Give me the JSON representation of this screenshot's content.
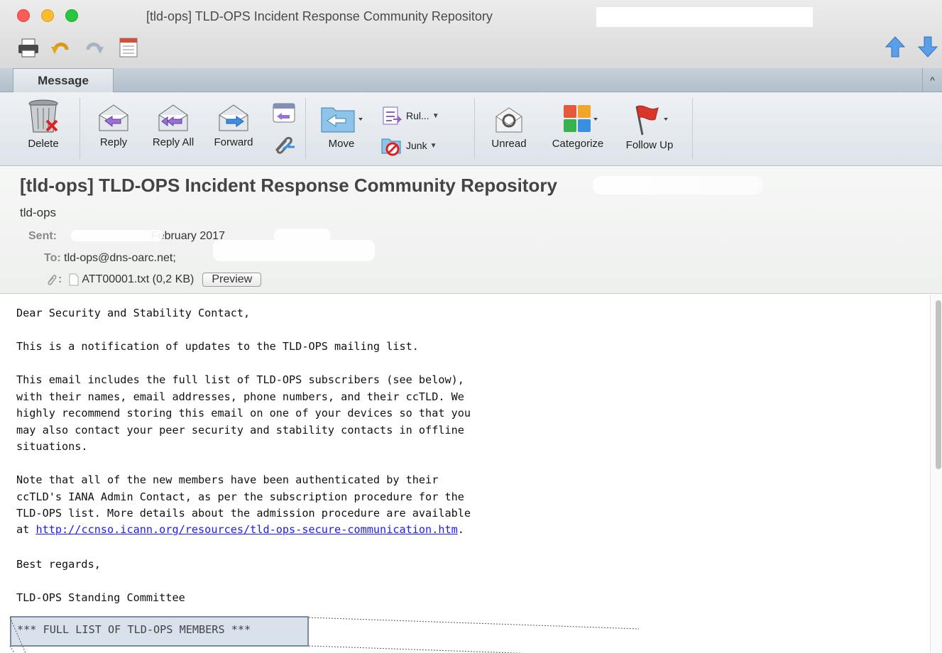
{
  "window": {
    "title": "[tld-ops] TLD-OPS Incident Response Community Repository"
  },
  "quick_toolbar": {
    "icons": [
      "print-icon",
      "undo-icon",
      "redo-icon",
      "calendar-view-icon"
    ],
    "nav_icons": [
      "previous-message-icon",
      "next-message-icon"
    ]
  },
  "tabs": {
    "message": "Message",
    "collapse": "^"
  },
  "ribbon": {
    "delete": "Delete",
    "reply": "Reply",
    "reply_all": "Reply All",
    "forward": "Forward",
    "move": "Move",
    "rules": "Rul...",
    "junk": "Junk",
    "unread": "Unread",
    "categorize": "Categorize",
    "follow_up": "Follow Up"
  },
  "header": {
    "subject": "[tld-ops] TLD-OPS Incident Response Community Repository",
    "sender": "tld-ops",
    "sent_label": "Sent:",
    "sent_value": "February 2017",
    "to_label": "To:",
    "to_value": "tld-ops@dns-oarc.net;",
    "attachment_label": ":",
    "attachment": "ATT00001.txt (0,2 KB)",
    "preview": "Preview"
  },
  "body": {
    "greeting": "Dear Security and Stability Contact,",
    "p1": "This is a notification of updates to the TLD-OPS mailing list.",
    "p2": "This email includes the full list of TLD-OPS subscribers (see below),\nwith their names, email addresses, phone numbers, and their ccTLD. We\nhighly recommend storing this email on one of your devices so that you\nmay also contact your peer security and stability contacts in offline\nsituations.",
    "p3": "Note that all of the new members have been authenticated by their\nccTLD's IANA Admin Contact, as per the subscription procedure for the\nTLD-OPS list. More details about the admission procedure are available",
    "p3_prefix": "at ",
    "p3_link": "http://ccnso.icann.org/resources/tld-ops-secure-communication.htm",
    "p3_suffix": ".",
    "regards": "Best regards,",
    "signature": "TLD-OPS Standing Committee",
    "highlight": "*** FULL LIST OF TLD-OPS MEMBERS ***"
  }
}
